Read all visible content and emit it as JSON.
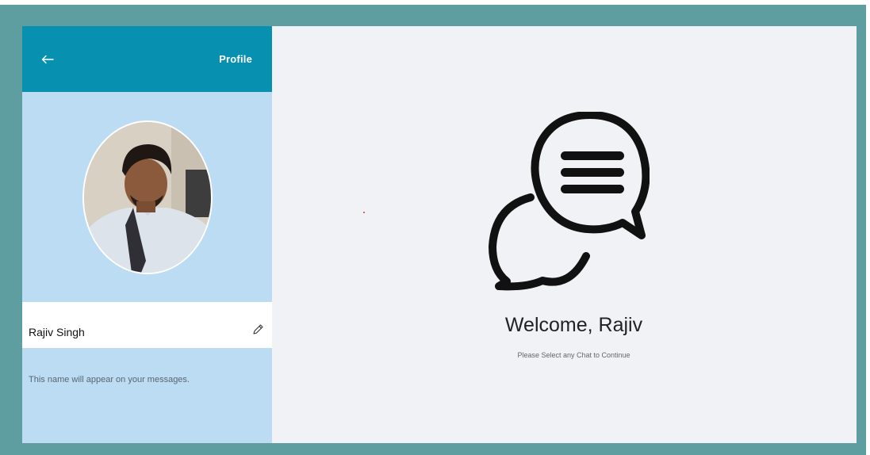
{
  "sidebar": {
    "header": {
      "back_icon": "arrow-left-icon",
      "title": "Profile"
    },
    "profile": {
      "name": "Rajiv Singh",
      "edit_icon": "pencil-icon",
      "hint": "This name will appear on your messages."
    }
  },
  "main": {
    "icon": "chat-bubbles-icon",
    "welcome": "Welcome, Rajiv",
    "subtitle": "Please Select any Chat to Continue"
  },
  "colors": {
    "frame": "#5f9ea0",
    "header": "#0890b0",
    "sidebar": "#bcdcf3",
    "main_bg": "#f0f2f5"
  }
}
